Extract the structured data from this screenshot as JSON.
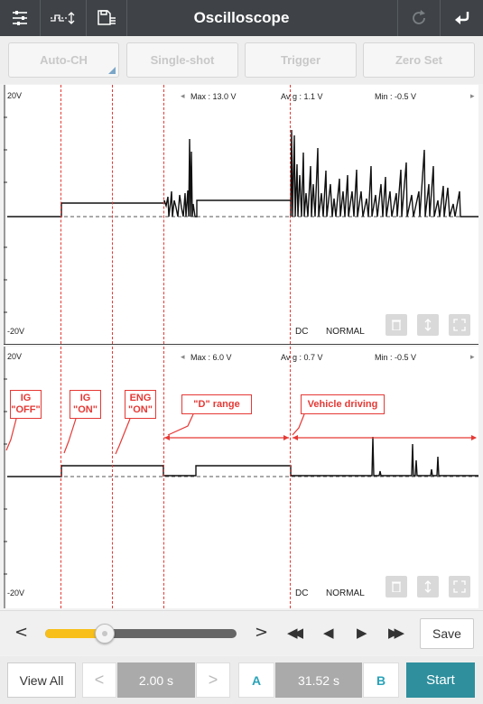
{
  "header": {
    "title": "Oscilloscope",
    "icons": [
      "sliders-icon",
      "channel-switch-icon",
      "save-file-icon",
      "refresh-icon",
      "back-arrow-icon"
    ]
  },
  "modes": {
    "auto_ch": "Auto-CH",
    "single_shot": "Single-shot",
    "trigger": "Trigger",
    "zero_set": "Zero Set"
  },
  "channel1": {
    "scale_top": "20V",
    "scale_bottom": "-20V",
    "max": "Max : 13.0 V",
    "avg_prefix": "Av",
    "avg_suffix": "g : 1.1 V",
    "min": "Min : -0.5 V",
    "coupling": "DC",
    "mode": "NORMAL"
  },
  "channel2": {
    "scale_top": "20V",
    "scale_bottom": "-20V",
    "max": "Max : 6.0 V",
    "avg_prefix": "Av",
    "avg_suffix": "g : 0.7 V",
    "min": "Min : -0.5 V",
    "coupling": "DC",
    "mode": "NORMAL"
  },
  "annotations": {
    "ig_off_1": "IG",
    "ig_off_2": "\"OFF\"",
    "ig_on_1": "IG",
    "ig_on_2": "\"ON\"",
    "eng_on_1": "ENG",
    "eng_on_2": "\"ON\"",
    "d_range": "\"D\" range",
    "vehicle_driving": "Vehicle driving"
  },
  "playback": {
    "position": 0.31,
    "save_label": "Save",
    "prev_glyph": "<",
    "next_glyph": ">",
    "rewind_glyph": "◀◀",
    "step_back_glyph": "◀",
    "play_glyph": "▶",
    "fast_forward_glyph": "▶▶"
  },
  "bottom": {
    "view_all": "View All",
    "time_div_prev": "<",
    "time_div": "2.00 s",
    "time_div_next": ">",
    "cursor_a": "A",
    "cursor_time": "31.52 s",
    "cursor_b": "B",
    "start": "Start"
  },
  "colors": {
    "header_bg": "#3f4347",
    "accent_teal": "#2f8f9d",
    "cursor_red": "#e53935",
    "slider_fill": "#f8bf1a"
  }
}
